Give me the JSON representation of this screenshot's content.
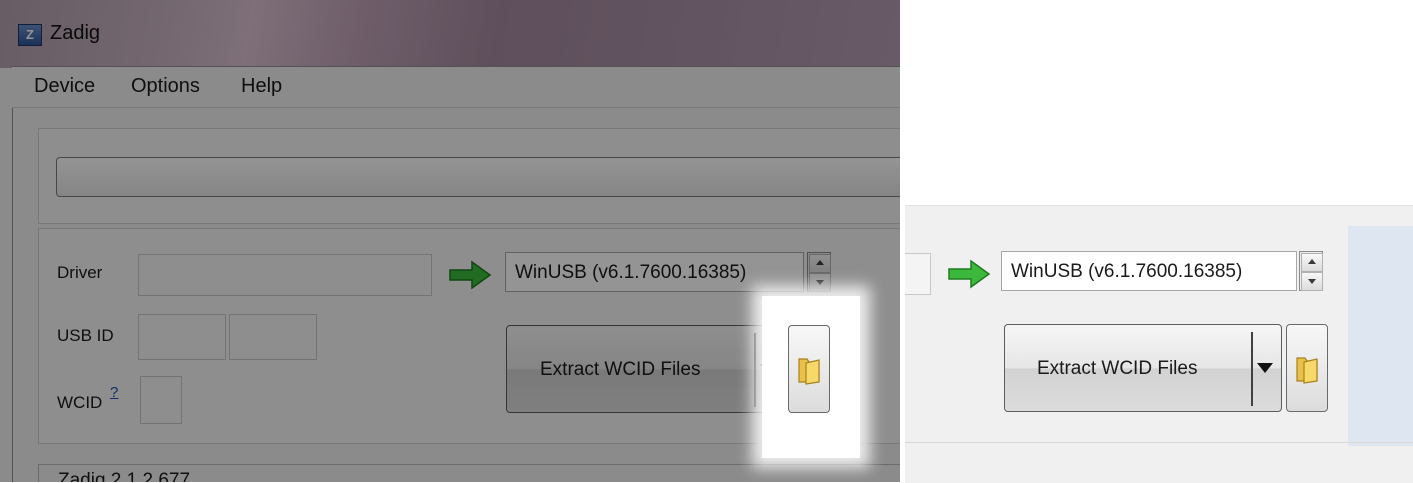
{
  "window": {
    "title": "Zadig",
    "icon_letter": "Z"
  },
  "menu": {
    "items": [
      {
        "label": "Device"
      },
      {
        "label": "Options"
      },
      {
        "label": "Help"
      }
    ]
  },
  "driver_panel": {
    "driver_label": "Driver",
    "usb_id_label": "USB ID",
    "wcid_label": "WCID",
    "wcid_help_link": "?",
    "target_driver": "WinUSB (v6.1.7600.16385)",
    "action_button_label": "Extract WCID Files"
  },
  "status_bar": {
    "text": "Zadig 2.1.2.677"
  },
  "icons": {
    "arrow": "green-right-arrow-icon",
    "folder": "folder-icon",
    "dropdown": "triangle-down-icon"
  },
  "colors": {
    "arrow_green": "#3cb83c",
    "link_blue": "#1a4fb5",
    "info_panel": "#dde6f1"
  }
}
